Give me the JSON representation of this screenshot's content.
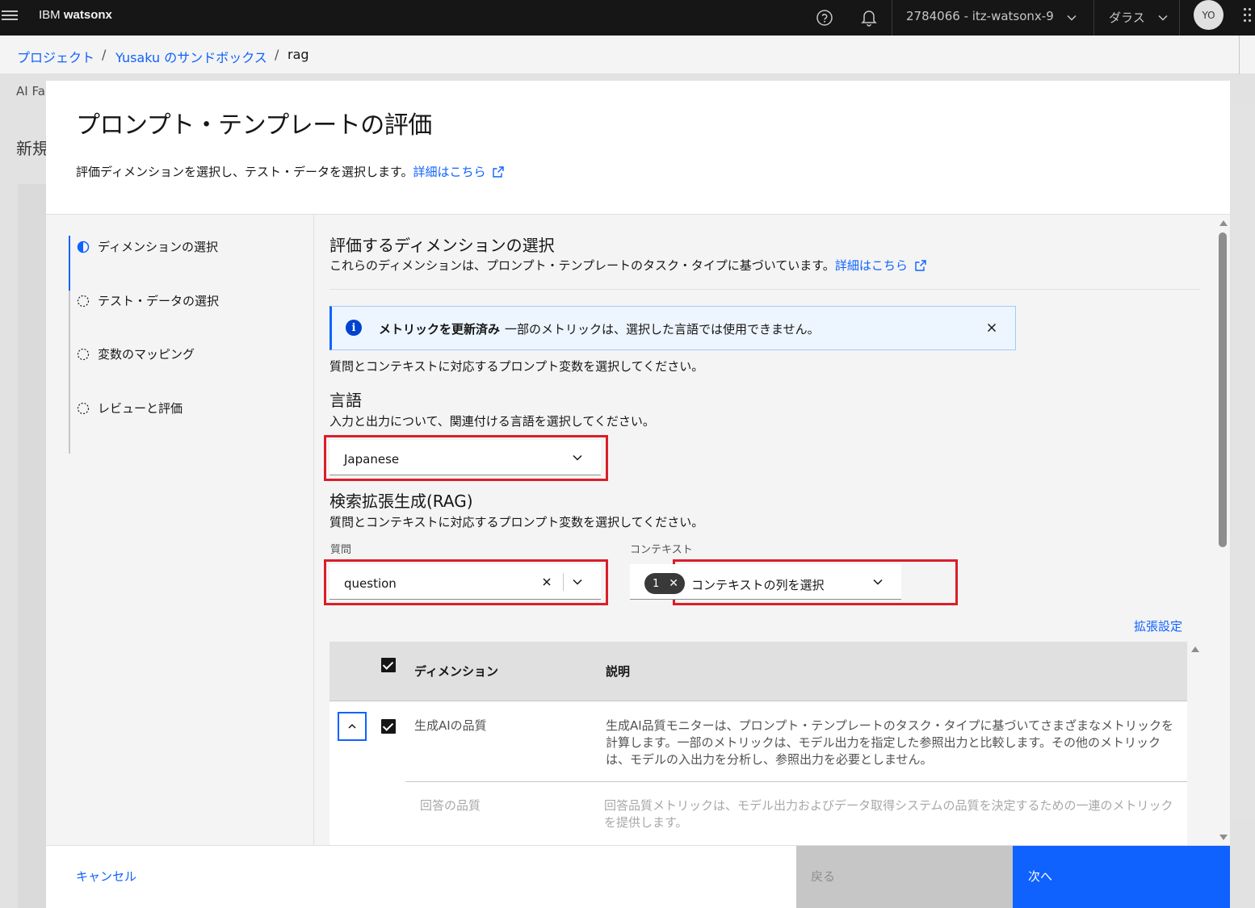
{
  "header": {
    "brand_prefix": "IBM",
    "brand_product": "watsonx",
    "account": "2784066 - itz-watsonx-9",
    "region": "ダラス",
    "avatar_initials": "YO",
    "icons": [
      "menu-icon",
      "help-icon",
      "notification-icon",
      "chevron-down-icon",
      "app-switcher-icon"
    ]
  },
  "breadcrumb": {
    "items": [
      "プロジェクト",
      "Yusaku のサンドボックス",
      "rag"
    ],
    "separator": "/"
  },
  "background": {
    "tab_label": "AI Fa",
    "page_title": "新規"
  },
  "modal": {
    "title": "プロンプト・テンプレートの評価",
    "subtitle": "評価ディメンションを選択し、テスト・データを選択します。",
    "learn_more": "詳細はこちら",
    "steps": [
      {
        "label": "ディメンションの選択",
        "state": "current"
      },
      {
        "label": "テスト・データの選択",
        "state": "incomplete"
      },
      {
        "label": "変数のマッピング",
        "state": "incomplete"
      },
      {
        "label": "レビューと評価",
        "state": "incomplete"
      }
    ],
    "section": {
      "title": "評価するディメンションの選択",
      "subtitle": "これらのディメンションは、プロンプト・テンプレートのタスク・タイプに基づいています。",
      "learn_more": "詳細はこちら"
    },
    "notification": {
      "title": "メトリックを更新済み",
      "message": "一部のメトリックは、選択した言語では使用できません。",
      "kind": "info"
    },
    "instruction": "質問とコンテキストに対応するプロンプト変数を選択してください。",
    "language": {
      "title": "言語",
      "subtitle": "入力と出力について、関連付ける言語を選択してください。",
      "selected": "Japanese"
    },
    "rag": {
      "title": "検索拡張生成(RAG)",
      "subtitle": "質問とコンテキストに対応するプロンプト変数を選択してください。",
      "question_label": "質問",
      "question_value": "question",
      "context_label": "コンテキスト",
      "context_count": "1",
      "context_placeholder": "コンテキストの列を選択"
    },
    "advanced_link": "拡張設定",
    "table": {
      "headers": [
        "ディメンション",
        "説明"
      ],
      "rows": [
        {
          "dimension": "生成AIの品質",
          "description": "生成AI品質モニターは、プロンプト・テンプレートのタスク・タイプに基づいてさまざまなメトリックを計算します。一部のメトリックは、モデル出力を指定した参照出力と比較します。その他のメトリックは、モデルの入出力を分析し、参照出力を必要としません。",
          "checked": true,
          "expanded": true
        },
        {
          "dimension": "回答の品質",
          "description": "回答品質メトリックは、モデル出力およびデータ取得システムの品質を決定するための一連のメトリックを提供します。",
          "checked": false,
          "expanded": false
        }
      ]
    },
    "footer": {
      "cancel": "キャンセル",
      "back": "戻る",
      "next": "次へ"
    }
  },
  "colors": {
    "primary": "#0f62fe",
    "highlight_border": "#da1e28",
    "header_bg": "#161616"
  }
}
